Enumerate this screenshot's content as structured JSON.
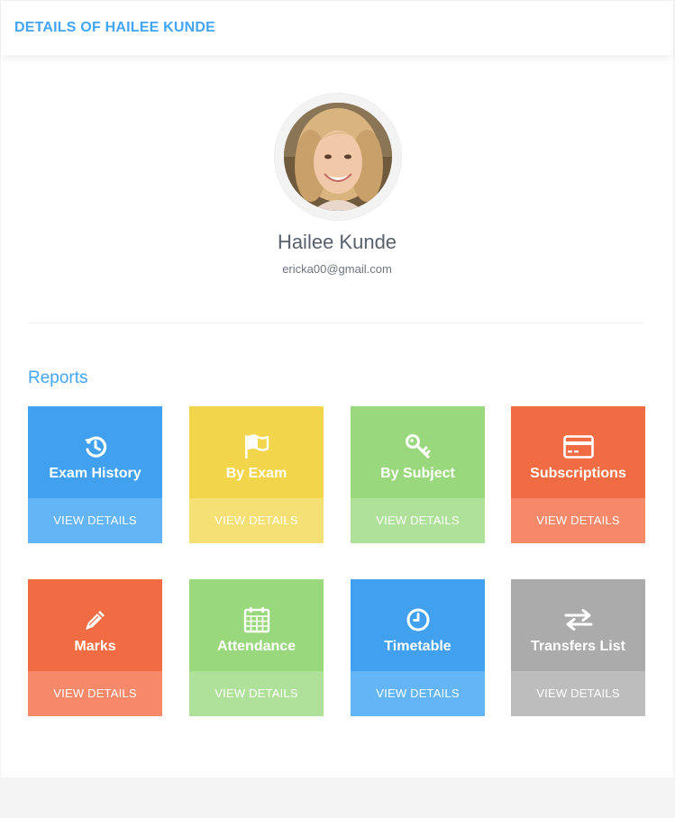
{
  "header": {
    "title": "DETAILS OF HAILEE KUNDE"
  },
  "profile": {
    "name": "Hailee Kunde",
    "email": "ericka00@gmail.com"
  },
  "reports": {
    "heading": "Reports",
    "tiles": [
      {
        "label": "Exam History",
        "action": "VIEW DETAILS",
        "icon": "history-icon",
        "color": "#42a0f1"
      },
      {
        "label": "By Exam",
        "action": "VIEW DETAILS",
        "icon": "flag-icon",
        "color": "#f2d54b"
      },
      {
        "label": "By Subject",
        "action": "VIEW DETAILS",
        "icon": "key-icon",
        "color": "#9ad87e"
      },
      {
        "label": "Subscriptions",
        "action": "VIEW DETAILS",
        "icon": "credit-card-icon",
        "color": "#f26c43"
      },
      {
        "label": "Marks",
        "action": "VIEW DETAILS",
        "icon": "pencil-icon",
        "color": "#f26c43"
      },
      {
        "label": "Attendance",
        "action": "VIEW DETAILS",
        "icon": "calendar-icon",
        "color": "#9ad87e"
      },
      {
        "label": "Timetable",
        "action": "VIEW DETAILS",
        "icon": "clock-icon",
        "color": "#42a0f1"
      },
      {
        "label": "Transfers List",
        "action": "VIEW DETAILS",
        "icon": "transfer-arrows-icon",
        "color": "#ababab"
      }
    ]
  },
  "colors": {
    "accent": "#42a5f5",
    "blue": "#42a0f1",
    "yellow": "#f2d54b",
    "green": "#9ad87e",
    "orange": "#f26c43",
    "gray": "#ababab"
  }
}
